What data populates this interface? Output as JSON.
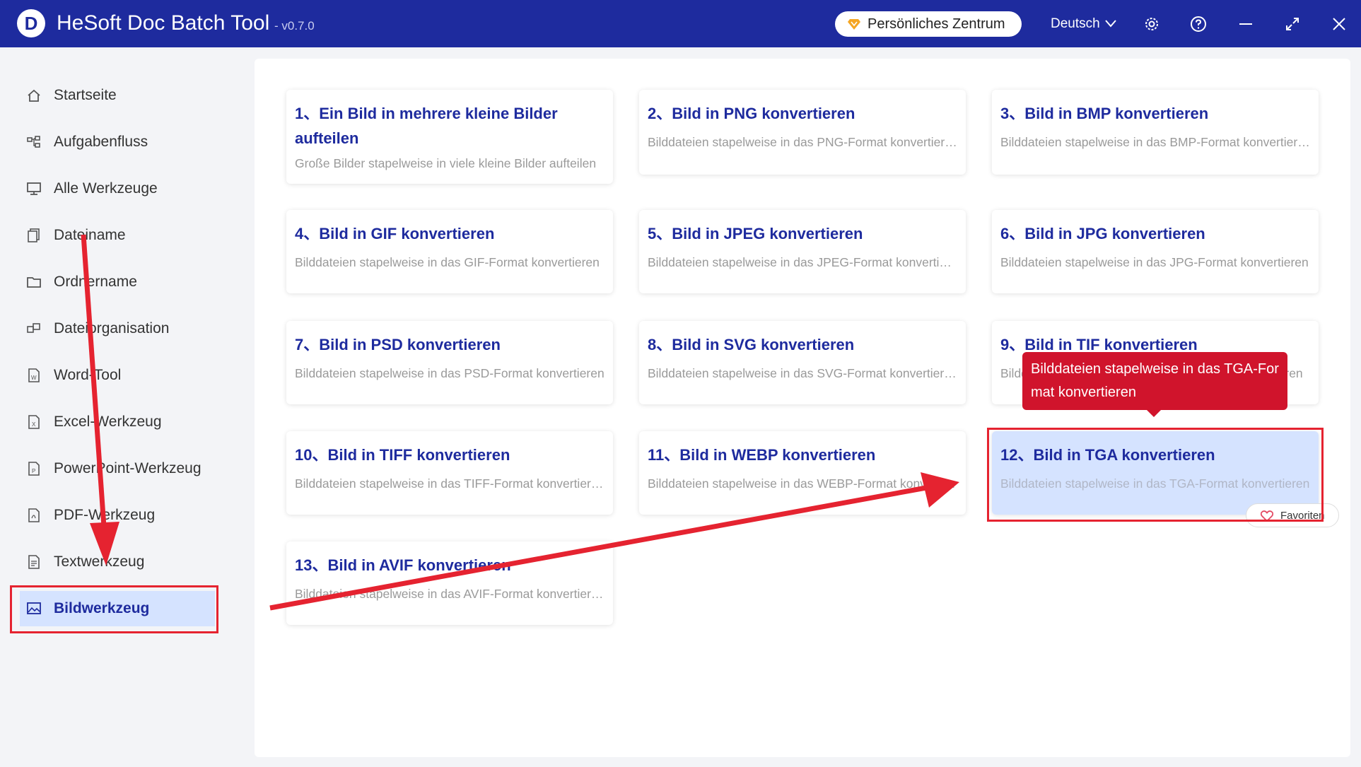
{
  "app": {
    "logo": "D",
    "title": "HeSoft Doc Batch Tool",
    "version": "- v0.7.0",
    "personal_center": "Persönliches Zentrum",
    "language": "Deutsch"
  },
  "sidebar": {
    "items": [
      {
        "label": "Startseite"
      },
      {
        "label": "Aufgabenfluss"
      },
      {
        "label": "Alle Werkzeuge"
      },
      {
        "label": "Dateiname"
      },
      {
        "label": "Ordnername"
      },
      {
        "label": "Dateiorganisation"
      },
      {
        "label": "Word-Tool"
      },
      {
        "label": "Excel-Werkzeug"
      },
      {
        "label": "PowerPoint-Werkzeug"
      },
      {
        "label": "PDF-Werkzeug"
      },
      {
        "label": "Textwerkzeug"
      },
      {
        "label": "Bildwerkzeug"
      }
    ],
    "active_index": 11
  },
  "tools": [
    {
      "title": "1、Ein Bild in mehrere kleine Bilder aufteilen",
      "desc": "Große Bilder stapelweise in viele kleine Bilder aufteilen"
    },
    {
      "title": "2、Bild in PNG konvertieren",
      "desc": "Bilddateien stapelweise in das PNG-Format konvertieren"
    },
    {
      "title": "3、Bild in BMP konvertieren",
      "desc": "Bilddateien stapelweise in das BMP-Format konvertieren"
    },
    {
      "title": "4、Bild in GIF konvertieren",
      "desc": "Bilddateien stapelweise in das GIF-Format konvertieren"
    },
    {
      "title": "5、Bild in JPEG konvertieren",
      "desc": "Bilddateien stapelweise in das JPEG-Format konvertieren"
    },
    {
      "title": "6、Bild in JPG konvertieren",
      "desc": "Bilddateien stapelweise in das JPG-Format konvertieren"
    },
    {
      "title": "7、Bild in PSD konvertieren",
      "desc": "Bilddateien stapelweise in das PSD-Format konvertieren"
    },
    {
      "title": "8、Bild in SVG konvertieren",
      "desc": "Bilddateien stapelweise in das SVG-Format konvertieren"
    },
    {
      "title": "9、Bild in TIF konvertieren",
      "desc": "Bilddateien stapelweise in das TIF-Format konvertieren"
    },
    {
      "title": "10、Bild in TIFF konvertieren",
      "desc": "Bilddateien stapelweise in das TIFF-Format konvertieren"
    },
    {
      "title": "11、Bild in WEBP konvertieren",
      "desc": "Bilddateien stapelweise in das WEBP-Format konvertieren"
    },
    {
      "title": "12、Bild in TGA konvertieren",
      "desc": "Bilddateien stapelweise in das TGA-Format konvertieren"
    },
    {
      "title": "13、Bild in AVIF konvertieren",
      "desc": "Bilddateien stapelweise in das AVIF-Format konvertieren"
    }
  ],
  "tooltip": "Bilddateien stapelweise in das TGA-Format konvertieren",
  "favorite_label": "Favoriten",
  "colors": {
    "titlebar": "#1e2b9e",
    "accent": "#1e2b9e",
    "highlight": "#d5e3ff",
    "annotation_red": "#e52330",
    "tooltip_red": "#d0142c"
  },
  "icons": {
    "titlebar": [
      "gear-icon",
      "help-icon",
      "minimize-icon",
      "maximize-icon",
      "close-icon"
    ],
    "sidebar": [
      "home-icon",
      "workflow-icon",
      "monitor-icon",
      "file-copy-icon",
      "folder-icon",
      "organize-icon",
      "word-doc-icon",
      "excel-doc-icon",
      "ppt-doc-icon",
      "pdf-doc-icon",
      "text-doc-icon",
      "image-icon"
    ]
  }
}
